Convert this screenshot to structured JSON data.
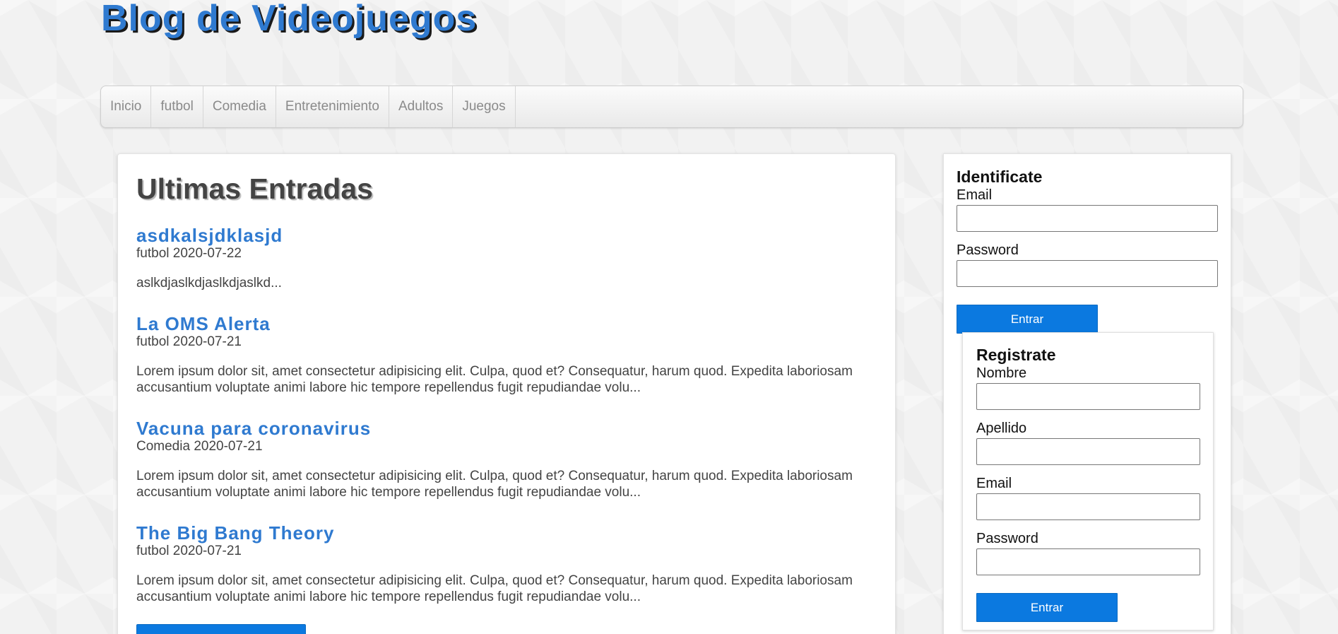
{
  "header": {
    "site_title": "Blog de Videojuegos"
  },
  "nav": {
    "items": [
      "Inicio",
      "futbol",
      "Comedia",
      "Entretenimiento",
      "Adultos",
      "Juegos"
    ]
  },
  "main": {
    "heading": "Ultimas Entradas",
    "posts": [
      {
        "title": "asdkalsjdklasjd",
        "category": "futbol",
        "date": "2020-07-22",
        "meta": "futbol 2020-07-22",
        "excerpt": "aslkdjaslkdjaslkdjaslkd..."
      },
      {
        "title": "La OMS Alerta",
        "category": "futbol",
        "date": "2020-07-21",
        "meta": "futbol 2020-07-21",
        "excerpt": "Lorem ipsum dolor sit, amet consectetur adipisicing elit. Culpa, quod et? Consequatur, harum quod. Expedita laboriosam accusantium voluptate animi labore hic tempore repellendus fugit repudiandae volu..."
      },
      {
        "title": "Vacuna para coronavirus",
        "category": "Comedia",
        "date": "2020-07-21",
        "meta": "Comedia 2020-07-21",
        "excerpt": "Lorem ipsum dolor sit, amet consectetur adipisicing elit. Culpa, quod et? Consequatur, harum quod. Expedita laboriosam accusantium voluptate animi labore hic tempore repellendus fugit repudiandae volu..."
      },
      {
        "title": "The Big Bang Theory",
        "category": "futbol",
        "date": "2020-07-21",
        "meta": "futbol 2020-07-21",
        "excerpt": "Lorem ipsum dolor sit, amet consectetur adipisicing elit. Culpa, quod et? Consequatur, harum quod. Expedita laboriosam accusantium voluptate animi labore hic tempore repellendus fugit repudiandae volu..."
      }
    ]
  },
  "login": {
    "heading": "Identificate",
    "email_label": "Email",
    "password_label": "Password",
    "submit_label": "Entrar"
  },
  "register": {
    "heading": "Registrate",
    "nombre_label": "Nombre",
    "apellido_label": "Apellido",
    "email_label": "Email",
    "password_label": "Password",
    "submit_label": "Entrar"
  },
  "colors": {
    "accent": "#2f7ad0",
    "button": "#0b79e0"
  }
}
